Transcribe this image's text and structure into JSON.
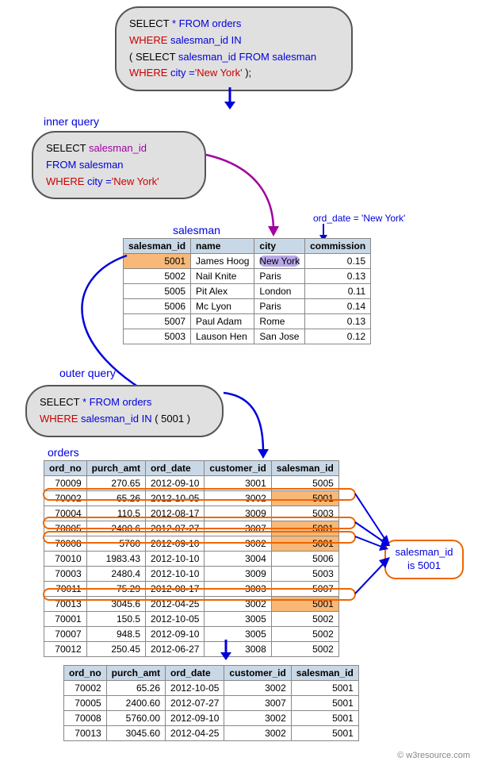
{
  "main_sql": {
    "l1a": "SELECT",
    "l1b": " * ",
    "l1c": "FROM",
    "l1d": " orders",
    "l2a": "WHERE",
    "l2b": " salesman_id ",
    "l2c": "IN",
    "l3a": "( ",
    "l3b": "SELECT",
    "l3c": " salesman_id ",
    "l3d": "FROM",
    "l3e": " salesman",
    "l4a": "WHERE",
    "l4b": " city =",
    "l4c": "'New York'",
    "l4d": " );"
  },
  "inner_label": "inner query",
  "inner_sql": {
    "l1a": "SELECT",
    "l1b": "  salesman_id",
    "l2a": "FROM",
    "l2b": " salesman",
    "l3a": "WHERE",
    "l3b": " city =",
    "l3c": "'New York'"
  },
  "annot_orddate": "ord_date = 'New York'",
  "salesman_title": "salesman",
  "salesman": {
    "headers": [
      "salesman_id",
      "name",
      "city",
      "commission"
    ],
    "rows": [
      {
        "id": "5001",
        "name": "James Hoog",
        "city": "New York",
        "comm": "0.15",
        "hl": true
      },
      {
        "id": "5002",
        "name": "Nail Knite",
        "city": "Paris",
        "comm": "0.13"
      },
      {
        "id": "5005",
        "name": "Pit Alex",
        "city": "London",
        "comm": "0.11"
      },
      {
        "id": "5006",
        "name": "Mc Lyon",
        "city": "Paris",
        "comm": "0.14"
      },
      {
        "id": "5007",
        "name": "Paul Adam",
        "city": "Rome",
        "comm": "0.13"
      },
      {
        "id": "5003",
        "name": "Lauson Hen",
        "city": "San Jose",
        "comm": "0.12"
      }
    ]
  },
  "outer_label": "outer query",
  "outer_sql": {
    "l1a": "SELECT",
    "l1b": " * ",
    "l1c": "FROM",
    "l1d": " orders",
    "l2a": "WHERE",
    "l2b": " salesman_id ",
    "l2c": "IN",
    "l2d": " ( 5001 )"
  },
  "orders_title": "orders",
  "orders": {
    "headers": [
      "ord_no",
      "purch_amt",
      "ord_date",
      "customer_id",
      "salesman_id"
    ],
    "rows": [
      {
        "o": "70009",
        "p": "270.65",
        "d": "2012-09-10",
        "c": "3001",
        "s": "5005"
      },
      {
        "o": "70002",
        "p": "65.26",
        "d": "2012-10-05",
        "c": "3002",
        "s": "5001",
        "hl": true
      },
      {
        "o": "70004",
        "p": "110.5",
        "d": "2012-08-17",
        "c": "3009",
        "s": "5003"
      },
      {
        "o": "70005",
        "p": "2400.6",
        "d": "2012-07-27",
        "c": "3007",
        "s": "5001",
        "hl": true
      },
      {
        "o": "70008",
        "p": "5760",
        "d": "2012-09-10",
        "c": "3002",
        "s": "5001",
        "hl": true
      },
      {
        "o": "70010",
        "p": "1983.43",
        "d": "2012-10-10",
        "c": "3004",
        "s": "5006"
      },
      {
        "o": "70003",
        "p": "2480.4",
        "d": "2012-10-10",
        "c": "3009",
        "s": "5003"
      },
      {
        "o": "70011",
        "p": "75.29",
        "d": "2012-08-17",
        "c": "3003",
        "s": "5007"
      },
      {
        "o": "70013",
        "p": "3045.6",
        "d": "2012-04-25",
        "c": "3002",
        "s": "5001",
        "hl": true
      },
      {
        "o": "70001",
        "p": "150.5",
        "d": "2012-10-05",
        "c": "3005",
        "s": "5002"
      },
      {
        "o": "70007",
        "p": "948.5",
        "d": "2012-09-10",
        "c": "3005",
        "s": "5002"
      },
      {
        "o": "70012",
        "p": "250.45",
        "d": "2012-06-27",
        "c": "3008",
        "s": "5002"
      }
    ]
  },
  "oval_label_l1": "salesman_id",
  "oval_label_l2": "is 5001",
  "result": {
    "headers": [
      "ord_no",
      "purch_amt",
      "ord_date",
      "customer_id",
      "salesman_id"
    ],
    "rows": [
      {
        "o": "70002",
        "p": "65.26",
        "d": "2012-10-05",
        "c": "3002",
        "s": "5001"
      },
      {
        "o": "70005",
        "p": "2400.60",
        "d": "2012-07-27",
        "c": "3007",
        "s": "5001"
      },
      {
        "o": "70008",
        "p": "5760.00",
        "d": "2012-09-10",
        "c": "3002",
        "s": "5001"
      },
      {
        "o": "70013",
        "p": "3045.60",
        "d": "2012-04-25",
        "c": "3002",
        "s": "5001"
      }
    ]
  },
  "footer": "© w3resource.com"
}
